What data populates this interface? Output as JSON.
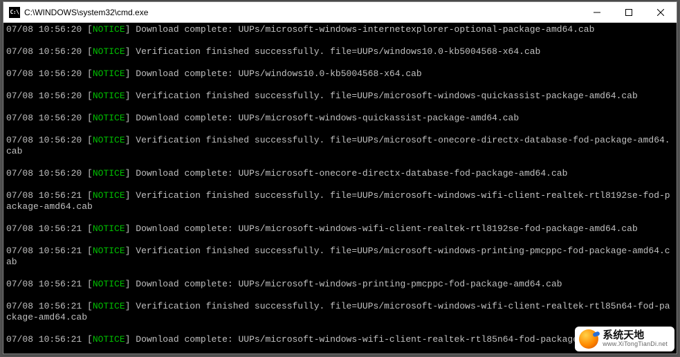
{
  "window": {
    "title": "C:\\WINDOWS\\system32\\cmd.exe",
    "icon_label": "C:\\"
  },
  "notice_label": "NOTICE",
  "log": [
    {
      "ts": "07/08 10:56:20",
      "msg": "Download complete: UUPs/microsoft-windows-internetexplorer-optional-package-amd64.cab"
    },
    {
      "ts": "07/08 10:56:20",
      "msg": "Verification finished successfully. file=UUPs/windows10.0-kb5004568-x64.cab"
    },
    {
      "ts": "07/08 10:56:20",
      "msg": "Download complete: UUPs/windows10.0-kb5004568-x64.cab"
    },
    {
      "ts": "07/08 10:56:20",
      "msg": "Verification finished successfully. file=UUPs/microsoft-windows-quickassist-package-amd64.cab"
    },
    {
      "ts": "07/08 10:56:20",
      "msg": "Download complete: UUPs/microsoft-windows-quickassist-package-amd64.cab"
    },
    {
      "ts": "07/08 10:56:20",
      "msg": "Verification finished successfully. file=UUPs/microsoft-onecore-directx-database-fod-package-amd64.cab"
    },
    {
      "ts": "07/08 10:56:20",
      "msg": "Download complete: UUPs/microsoft-onecore-directx-database-fod-package-amd64.cab"
    },
    {
      "ts": "07/08 10:56:21",
      "msg": "Verification finished successfully. file=UUPs/microsoft-windows-wifi-client-realtek-rtl8192se-fod-package-amd64.cab"
    },
    {
      "ts": "07/08 10:56:21",
      "msg": "Download complete: UUPs/microsoft-windows-wifi-client-realtek-rtl8192se-fod-package-amd64.cab"
    },
    {
      "ts": "07/08 10:56:21",
      "msg": "Verification finished successfully. file=UUPs/microsoft-windows-printing-pmcppc-fod-package-amd64.cab"
    },
    {
      "ts": "07/08 10:56:21",
      "msg": "Download complete: UUPs/microsoft-windows-printing-pmcppc-fod-package-amd64.cab"
    },
    {
      "ts": "07/08 10:56:21",
      "msg": "Verification finished successfully. file=UUPs/microsoft-windows-wifi-client-realtek-rtl85n64-fod-package-amd64.cab"
    },
    {
      "ts": "07/08 10:56:21",
      "msg": "Download complete: UUPs/microsoft-windows-wifi-client-realtek-rtl85n64-fod-package-a"
    }
  ],
  "watermark": {
    "title": "系统天地",
    "url": "www.XiTongTianDi.net"
  }
}
